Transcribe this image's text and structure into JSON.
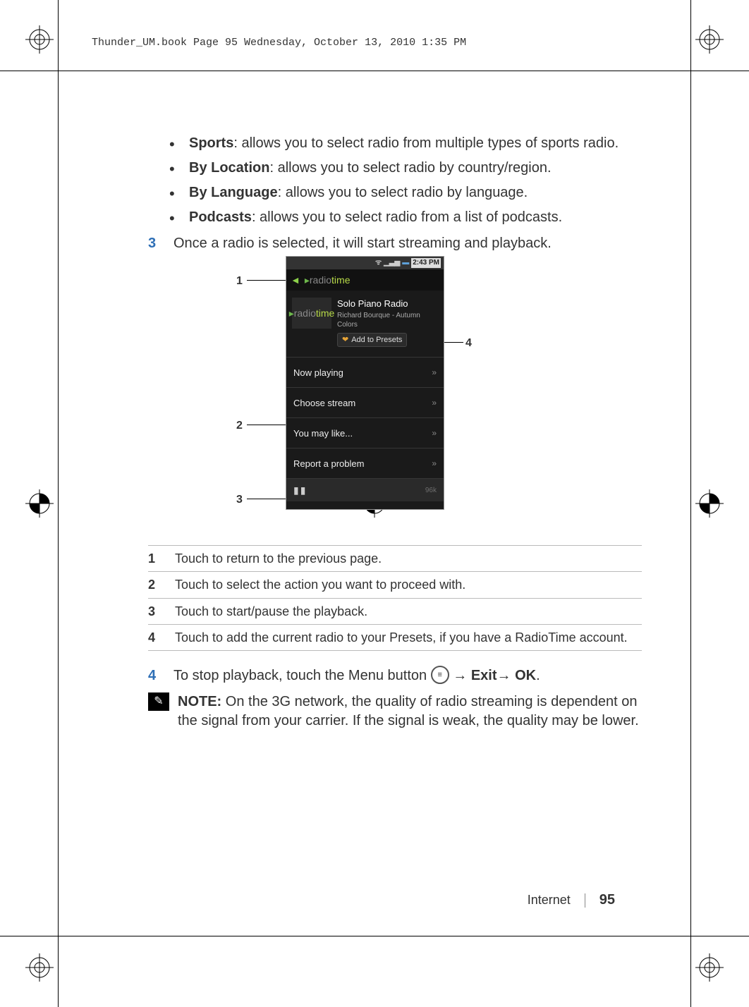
{
  "book_header": "Thunder_UM.book  Page 95  Wednesday, October 13, 2010  1:35 PM",
  "bullets": [
    {
      "label": "Sports",
      "desc": ": allows you to select radio from multiple types of sports radio."
    },
    {
      "label": "By Location",
      "desc": ": allows you to select radio by country/region."
    },
    {
      "label": "By Language",
      "desc": ": allows you to select radio by language."
    },
    {
      "label": "Podcasts",
      "desc": ": allows you to select radio from a list of podcasts."
    }
  ],
  "step3": {
    "num": "3",
    "text": "Once a radio is selected, it will start streaming and playback."
  },
  "phone": {
    "status_time": "2:43 PM",
    "brand_a": "radio",
    "brand_b": "time",
    "now_title": "Solo Piano Radio",
    "now_sub": "Richard Bourque - Autumn Colors",
    "preset_btn": "Add to Presets",
    "menu": [
      "Now playing",
      "Choose stream",
      "You may like...",
      "Report a problem"
    ],
    "rate": "96k"
  },
  "callouts": {
    "c1": "1",
    "c2": "2",
    "c3": "3",
    "c4": "4"
  },
  "table": {
    "r1": {
      "n": "1",
      "t": "Touch to return to the previous page."
    },
    "r2": {
      "n": "2",
      "t": "Touch to select the action you want to proceed with."
    },
    "r3": {
      "n": "3",
      "t": "Touch to start/pause the playback."
    },
    "r4": {
      "n": "4",
      "t": "Touch to add the current radio to your Presets, if you have a RadioTime account."
    }
  },
  "step4": {
    "num": "4",
    "prefix": "To stop playback, touch the Menu button ",
    "arrow1": "→ ",
    "exit": "Exit",
    "arrow2": "→ ",
    "ok": "OK",
    "period": "."
  },
  "note": {
    "label": "NOTE:",
    "text": " On the 3G network, the quality of radio streaming is dependent on the signal from your carrier. If the signal is weak, the quality may be lower."
  },
  "footer": {
    "section": "Internet",
    "page": "95"
  }
}
